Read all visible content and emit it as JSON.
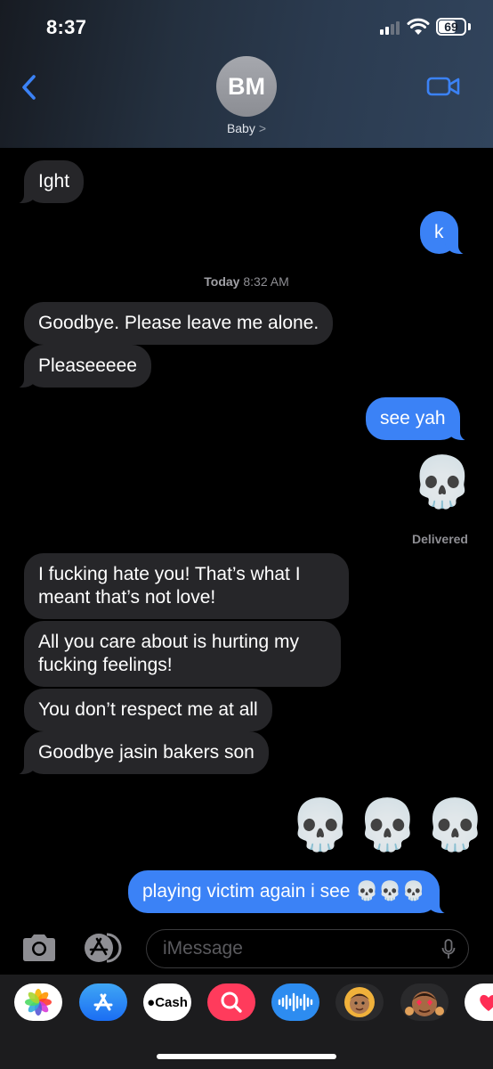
{
  "status_bar": {
    "time": "8:37",
    "battery": "69",
    "battery_level": 0.69
  },
  "header": {
    "avatar_initials": "BM",
    "contact_name": "Baby",
    "chevron": ">",
    "back_icon": "chevron-left-icon",
    "video_icon": "video-camera-icon",
    "accent_color": "#3b82f6"
  },
  "messages": [
    {
      "direction": "incoming",
      "text": "Ight"
    },
    {
      "direction": "outgoing",
      "text": "k"
    },
    {
      "type": "timestamp",
      "day": "Today",
      "time": "8:32 AM"
    },
    {
      "direction": "incoming",
      "text": "Goodbye. Please leave me alone."
    },
    {
      "direction": "incoming",
      "text": "Pleaseeeee"
    },
    {
      "direction": "outgoing",
      "text": "see yah"
    },
    {
      "direction": "outgoing",
      "type": "emoji",
      "text": "💀"
    },
    {
      "type": "status",
      "text": "Delivered"
    },
    {
      "direction": "incoming",
      "text": " I fucking hate you! That’s what I meant that’s not love!"
    },
    {
      "direction": "incoming",
      "text": "All you care about is hurting my fucking feelings!"
    },
    {
      "direction": "incoming",
      "text": "You don’t respect me at all"
    },
    {
      "direction": "incoming",
      "text": "Goodbye jasin bakers son"
    },
    {
      "direction": "outgoing",
      "type": "emoji",
      "text": "💀💀💀"
    },
    {
      "direction": "outgoing",
      "text": "playing victim again i see 💀💀💀"
    }
  ],
  "input": {
    "placeholder": "iMessage",
    "camera_icon": "camera-icon",
    "apps_icon": "app-store-icon",
    "mic_icon": "microphone-icon"
  },
  "app_drawer": {
    "apps": [
      {
        "name": "photos-icon"
      },
      {
        "name": "app-store-icon"
      },
      {
        "name": "apple-cash-icon",
        "label": "Cash"
      },
      {
        "name": "search-images-icon"
      },
      {
        "name": "audio-message-icon"
      },
      {
        "name": "memoji-icon"
      },
      {
        "name": "memoji-stickers-icon"
      },
      {
        "name": "digital-touch-icon"
      }
    ]
  }
}
